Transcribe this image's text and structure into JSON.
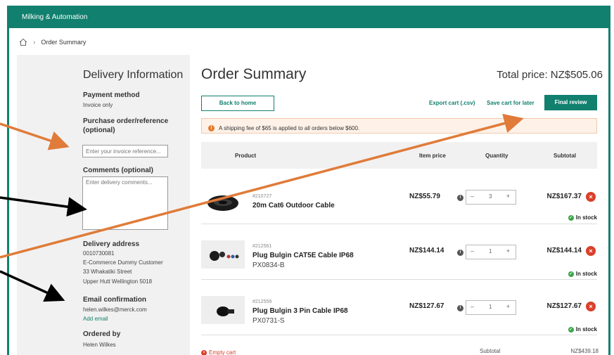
{
  "topbar": {
    "title": "Milking & Automation"
  },
  "breadcrumb": {
    "current": "Order Summary"
  },
  "sidebar": {
    "title": "Delivery Information",
    "payment_label": "Payment method",
    "payment_value": "Invoice only",
    "po_label_1": "Purchase order/reference",
    "po_label_2": "(optional)",
    "po_placeholder": "Enter your invoice reference...",
    "comments_label": "Comments (optional)",
    "comments_placeholder": "Enter delivery comments...",
    "address_label": "Delivery address",
    "address_lines": [
      "0010730081",
      "E-Commerce Dummy Customer",
      "33 Whakatiki Street",
      "Upper Hutt Wellington 5018"
    ],
    "email_label": "Email confirmation",
    "email_value": "helen.wilkes@merck.com",
    "add_email": "Add email",
    "ordered_label": "Ordered by",
    "ordered_value": "Helen Wilkes"
  },
  "main": {
    "title": "Order Summary",
    "total": "Total price: NZ$505.06",
    "back_button": "Back to home",
    "export_link": "Export cart (.csv)",
    "save_link": "Save cart for later",
    "final_button": "Final review",
    "notice": "A shipping fee of $65 is applied to all orders below $600.",
    "columns": {
      "product": "Product",
      "item_price": "Item price",
      "quantity": "Quantity",
      "subtotal": "Subtotal"
    },
    "items": [
      {
        "sku": "#210727",
        "name": "20m Cat6 Outdoor Cable",
        "code": "",
        "price": "NZ$55.79",
        "qty": "3",
        "subtotal": "NZ$167.37",
        "stock": "In stock"
      },
      {
        "sku": "#212561",
        "name": "Plug Bulgin CAT5E Cable IP68",
        "code": "PX0834-B",
        "price": "NZ$144.14",
        "qty": "1",
        "subtotal": "NZ$144.14",
        "stock": "In stock"
      },
      {
        "sku": "#212559",
        "name": "Plug Bulgin 3 Pin Cable IP68",
        "code": "PX0731-S",
        "price": "NZ$127.67",
        "qty": "1",
        "subtotal": "NZ$127.67",
        "stock": "In stock"
      }
    ],
    "empty_cart": "Empty cart",
    "footer_subtotal_label": "Subtotal",
    "footer_subtotal_value": "NZ$439.18"
  },
  "colors": {
    "brand": "#11806e",
    "annotation_orange": "#e07b39",
    "annotation_black": "#000000"
  },
  "icons": {
    "home": "home-icon",
    "info": "info-icon",
    "remove": "remove-icon",
    "stock": "check-icon"
  }
}
